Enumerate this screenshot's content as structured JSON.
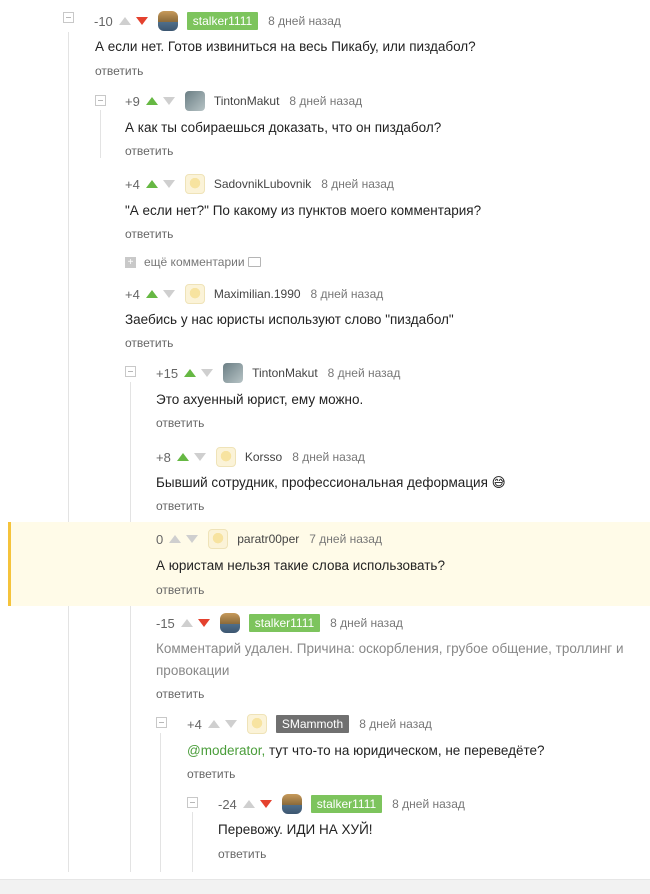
{
  "reply_label": "ответить",
  "more_comments_label": "ещё комментарии",
  "comments": [
    {
      "rating": "-10",
      "nick": "stalker1111",
      "time": "8 дней назад",
      "text": "А если нет. Готов извиниться на весь Пикабу, или пиздабол?"
    },
    {
      "rating": "+9",
      "nick": "TintonMakut",
      "time": "8 дней назад",
      "text": "А как ты собираешься доказать, что он пиздабол?"
    },
    {
      "rating": "+4",
      "nick": "SadovnikLubovnik",
      "time": "8 дней назад",
      "text": "\"А если нет?\" По какому из пунктов моего комментария?"
    },
    {
      "rating": "+4",
      "nick": "Maximilian.1990",
      "time": "8 дней назад",
      "text": "Заебись у нас юристы используют слово \"пиздабол\""
    },
    {
      "rating": "+15",
      "nick": "TintonMakut",
      "time": "8 дней назад",
      "text": "Это ахуенный юрист, ему можно."
    },
    {
      "rating": "+8",
      "nick": "Korsso",
      "time": "8 дней назад",
      "text": "Бывший сотрудник, профессиональная деформация 😅"
    },
    {
      "rating": "0",
      "nick": "paratr00per",
      "time": "7 дней назад",
      "text": "А юристам нельзя такие слова использовать?"
    },
    {
      "rating": "-15",
      "nick": "stalker1111",
      "time": "8 дней назад",
      "text_line1": "Комментарий удален. Причина: оскорбления, грубое общение, троллинг и",
      "text_line2": "провокации"
    },
    {
      "rating": "+4",
      "nick": "SMammoth",
      "time": "8 дней назад",
      "mention": "@moderator,",
      "text": " тут что-то на юридическом, не переведёте?"
    },
    {
      "rating": "-24",
      "nick": "stalker1111",
      "time": "8 дней назад",
      "text": "Перевожу. ИДИ НА ХУЙ!"
    }
  ]
}
